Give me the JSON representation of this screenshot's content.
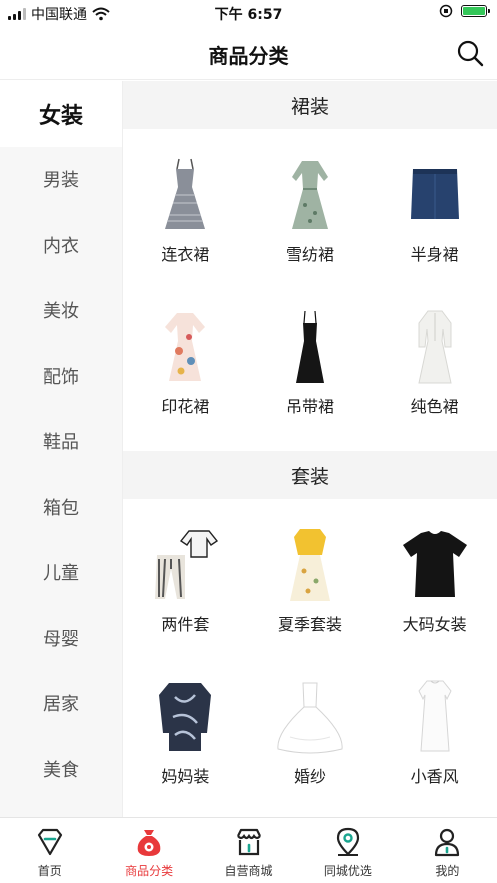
{
  "status_bar": {
    "carrier": "中国联通",
    "time": "下午 6:57"
  },
  "header": {
    "title": "商品分类"
  },
  "sidebar": {
    "items": [
      {
        "label": "女装",
        "active": true
      },
      {
        "label": "男装"
      },
      {
        "label": "内衣"
      },
      {
        "label": "美妆"
      },
      {
        "label": "配饰"
      },
      {
        "label": "鞋品"
      },
      {
        "label": "箱包"
      },
      {
        "label": "儿童"
      },
      {
        "label": "母婴"
      },
      {
        "label": "居家"
      },
      {
        "label": "美食"
      }
    ]
  },
  "content": {
    "sections": [
      {
        "title": "裙装",
        "items": [
          {
            "label": "连衣裙"
          },
          {
            "label": "雪纺裙"
          },
          {
            "label": "半身裙"
          },
          {
            "label": "印花裙"
          },
          {
            "label": "吊带裙"
          },
          {
            "label": "纯色裙"
          }
        ]
      },
      {
        "title": "套装",
        "items": [
          {
            "label": "两件套"
          },
          {
            "label": "夏季套装"
          },
          {
            "label": "大码女装"
          },
          {
            "label": "妈妈装"
          },
          {
            "label": "婚纱"
          },
          {
            "label": "小香风"
          }
        ]
      }
    ]
  },
  "tabbar": {
    "tabs": [
      {
        "label": "首页"
      },
      {
        "label": "商品分类",
        "active": true
      },
      {
        "label": "自营商城"
      },
      {
        "label": "同城优选"
      },
      {
        "label": "我的"
      }
    ]
  },
  "colors": {
    "accent": "#e8393b",
    "teal": "#1aa58f",
    "battery": "#34c759"
  }
}
